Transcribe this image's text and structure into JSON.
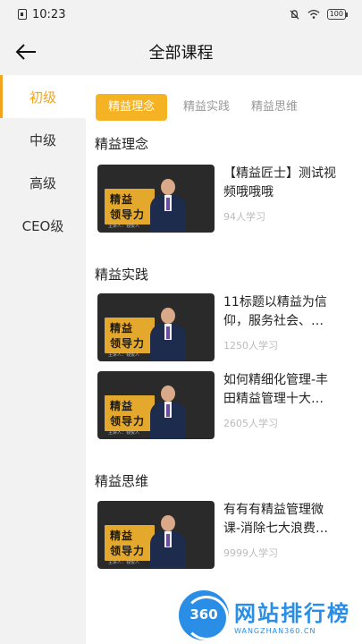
{
  "status_bar": {
    "time": "10:23",
    "battery": "100"
  },
  "header": {
    "title": "全部课程"
  },
  "sidebar": {
    "items": [
      {
        "label": "初级",
        "active": true
      },
      {
        "label": "中级"
      },
      {
        "label": "高级"
      },
      {
        "label": "CEO级"
      }
    ]
  },
  "tabs": [
    {
      "label": "精益理念",
      "active": true
    },
    {
      "label": "精益实践"
    },
    {
      "label": "精益思维"
    }
  ],
  "sections": [
    {
      "title": "精益理念",
      "courses": [
        {
          "title": "【精益匠士】测试视频哦哦哦",
          "learners": "94人学习"
        }
      ]
    },
    {
      "title": "精益实践",
      "courses": [
        {
          "title": "11标题以精益为信仰，服务社会、…",
          "learners": "1250人学习"
        },
        {
          "title": "如何精细化管理-丰田精益管理十大…",
          "learners": "2605人学习"
        }
      ]
    },
    {
      "title": "精益思维",
      "courses": [
        {
          "title": "有有有精益管理微课-消除七大浪费…",
          "learners": "9999人学习"
        }
      ]
    }
  ],
  "thumbnail": {
    "line1": "精益",
    "line2": "领导力",
    "caption": "主讲人：钱俊人"
  },
  "watermark": {
    "logo": "360",
    "title": "网站排行榜",
    "subtitle": "WANGZHAN360.CN"
  },
  "colors": {
    "accent": "#f5b223",
    "accent_text": "#f2a31f"
  }
}
